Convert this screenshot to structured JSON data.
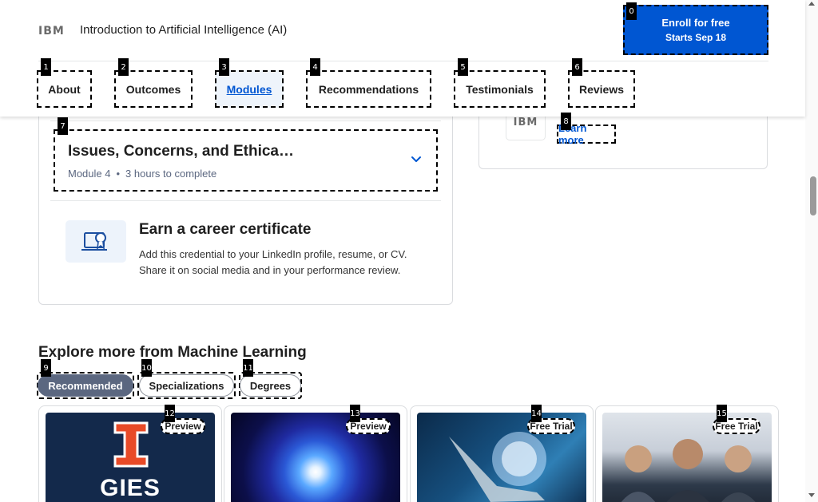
{
  "header": {
    "logo": "IBM",
    "course_title": "Introduction to Artificial Intelligence (AI)",
    "enroll_label": "Enroll for free",
    "enroll_sub": "Starts Sep 18"
  },
  "nav_tabs": [
    {
      "label": "About",
      "marker": "1"
    },
    {
      "label": "Outcomes",
      "marker": "2"
    },
    {
      "label": "Modules",
      "marker": "3",
      "active": true
    },
    {
      "label": "Recommendations",
      "marker": "4"
    },
    {
      "label": "Testimonials",
      "marker": "5"
    },
    {
      "label": "Reviews",
      "marker": "6"
    }
  ],
  "markers": {
    "enroll": "0",
    "module": "7",
    "learn_more": "8",
    "filters": [
      "9",
      "10",
      "11"
    ],
    "badges": [
      "12",
      "13",
      "14",
      "15"
    ]
  },
  "module": {
    "title": "Issues, Concerns, and Ethica…",
    "number": "Module 4",
    "duration": "3 hours to complete"
  },
  "certificate": {
    "title": "Earn a career certificate",
    "description": "Add this credential to your LinkedIn profile, resume, or CV. Share it on social media and in your performance review."
  },
  "partner": {
    "logo": "IBM",
    "learn_more": "Learn more"
  },
  "explore": {
    "title": "Explore more from Machine Learning",
    "filters": [
      {
        "label": "Recommended",
        "active": true
      },
      {
        "label": "Specializations"
      },
      {
        "label": "Degrees"
      }
    ]
  },
  "recommendations": [
    {
      "badge": "Preview",
      "image": "gies-logo"
    },
    {
      "badge": "Preview",
      "image": "galaxy"
    },
    {
      "badge": "Free Trial",
      "image": "robot-hand-brain"
    },
    {
      "badge": "Free Trial",
      "image": "business-team"
    }
  ],
  "gies_text": "GIES",
  "colors": {
    "brand_blue": "#0056d2",
    "chip_active": "#5b6780",
    "gies_navy": "#13294b",
    "gies_orange": "#e84a27"
  },
  "icons": {
    "module_chevron": "chevron-down-icon",
    "certificate": "certificate-icon"
  }
}
